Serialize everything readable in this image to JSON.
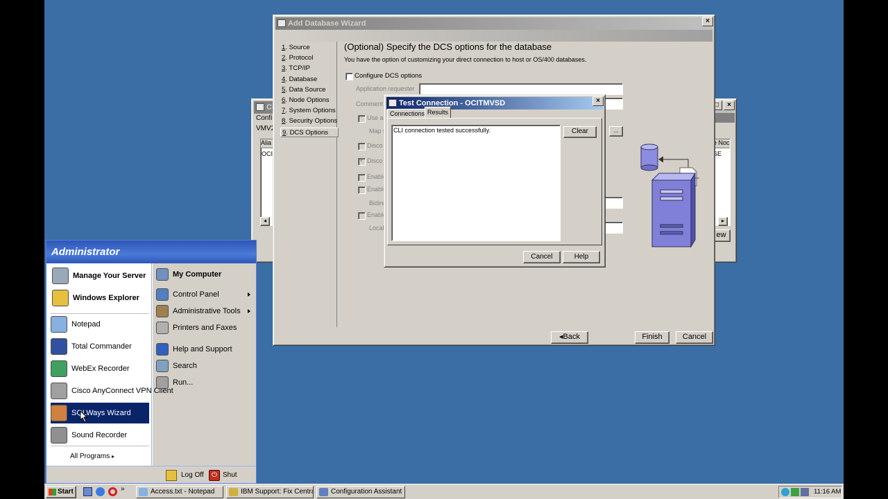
{
  "back_window": {
    "title": "Co",
    "menu": "Confi",
    "row2": "VMV2",
    "col1_header": "Alia",
    "col1_value": "OCI",
    "col_right_header": "e Noc",
    "col_right_value": "SE",
    "button": "ew"
  },
  "wizard": {
    "title": "Add Database Wizard",
    "steps": [
      {
        "num": "1",
        "label": ". Source"
      },
      {
        "num": "2",
        "label": ". Protocol"
      },
      {
        "num": "3",
        "label": ". TCP/IP"
      },
      {
        "num": "4",
        "label": ". Database"
      },
      {
        "num": "5",
        "label": ". Data Source"
      },
      {
        "num": "6",
        "label": ". Node Options"
      },
      {
        "num": "7",
        "label": ". System Options"
      },
      {
        "num": "8",
        "label": ". Security Options"
      },
      {
        "num": "9",
        "label": ". DCS Options"
      }
    ],
    "heading": "(Optional) Specify the DCS options for the database",
    "description": "You have the option of customizing your direct connection to host or OS/400 databases.",
    "configure_dcs": "Configure DCS options",
    "app_requester": "Application requester",
    "comment": "Comment",
    "use_a": "Use a",
    "map": "Map t",
    "disco1": "Disco",
    "disco2": "Disco",
    "enable1": "Enable",
    "enable2": "Enable",
    "bidire": "Bidire",
    "enable3": "Enable",
    "local": "Local",
    "browse": "...",
    "back": "Back",
    "finish": "Finish",
    "cancel": "Cancel"
  },
  "test_dialog": {
    "title": "Test Connection - OCITMVSD",
    "tab_connections": "Connections",
    "tab_results": "Results",
    "result_text": "CLI connection tested successfully.",
    "clear": "Clear",
    "cancel": "Cancel",
    "help": "Help"
  },
  "start_menu": {
    "user": "Administrator",
    "pinned": [
      {
        "label": "Manage Your Server",
        "icon": "server-icon"
      },
      {
        "label": "Windows Explorer",
        "icon": "explorer-icon"
      }
    ],
    "recent": [
      {
        "label": "Notepad",
        "icon": "notepad-icon"
      },
      {
        "label": "Total Commander",
        "icon": "floppy-icon"
      },
      {
        "label": "WebEx Recorder",
        "icon": "webex-icon"
      },
      {
        "label": "Cisco AnyConnect VPN Client",
        "icon": "vpn-icon"
      },
      {
        "label": "SQLWays Wizard",
        "icon": "sqlways-icon"
      },
      {
        "label": "Sound Recorder",
        "icon": "speaker-icon"
      }
    ],
    "all_programs": "All Programs",
    "right": [
      {
        "label": "My Computer",
        "icon": "computer-icon"
      },
      {
        "label": "Control Panel",
        "icon": "control-panel-icon"
      },
      {
        "label": "Administrative Tools",
        "icon": "admin-tools-icon"
      },
      {
        "label": "Printers and Faxes",
        "icon": "printer-icon"
      },
      {
        "label": "Help and Support",
        "icon": "help-icon"
      },
      {
        "label": "Search",
        "icon": "search-icon"
      },
      {
        "label": "Run...",
        "icon": "run-icon"
      }
    ],
    "log_off": "Log Off",
    "shut_down": "Shut Down"
  },
  "taskbar": {
    "start": "Start",
    "tasks": [
      {
        "label": "Access.txt - Notepad"
      },
      {
        "label": "IBM Support: Fix Central..."
      },
      {
        "label": "Configuration Assistant"
      }
    ],
    "clock": "11:16 AM"
  },
  "colors": {
    "desktop": "#3a6ea5",
    "selection": "#0a246a",
    "start_menu_header": "#2f5597"
  }
}
